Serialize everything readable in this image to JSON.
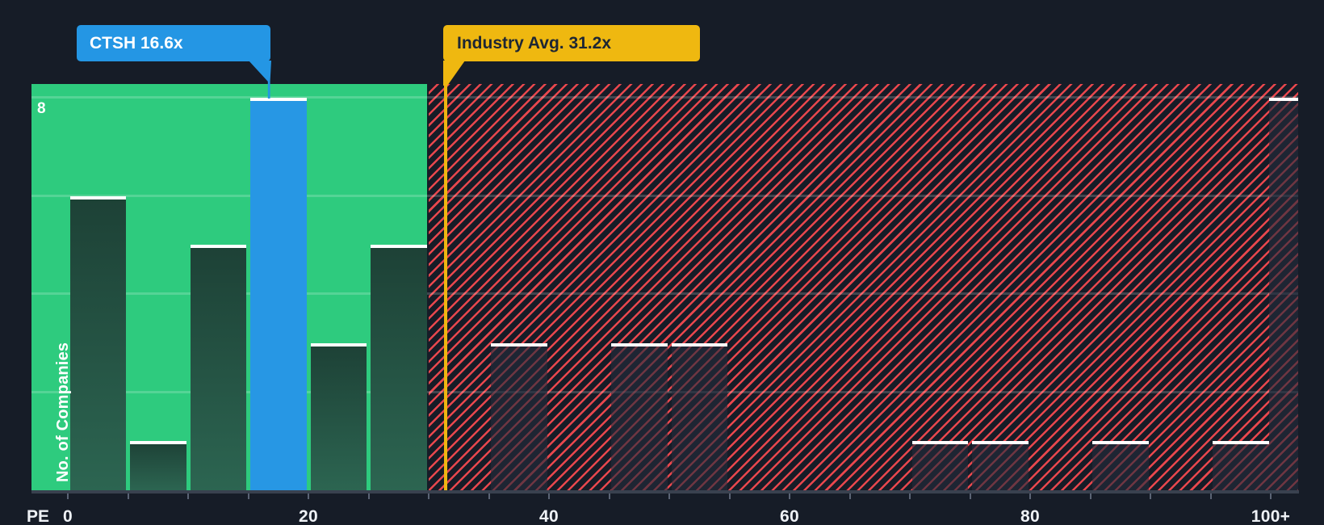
{
  "tooltips": {
    "company": {
      "label": "CTSH 16.6x",
      "color": "#2496e4",
      "text_color": "#ffffff"
    },
    "industry": {
      "label": "Industry Avg. 31.2x",
      "color": "#efb810",
      "text_color": "#1d2634"
    }
  },
  "axes": {
    "x_title": "PE",
    "y_title": "No. of Companies",
    "y_max_label": "8"
  },
  "chart_data": {
    "type": "bar",
    "title": "PE ratio histogram vs industry",
    "xlabel": "PE",
    "ylabel": "No. of Companies",
    "ylim": [
      0,
      8.3
    ],
    "xlim": [
      -3,
      102.5
    ],
    "grid": true,
    "gridline_values": [
      2,
      4,
      6,
      8
    ],
    "x_ticks": [
      {
        "pe": 0,
        "label": "0"
      },
      {
        "pe": 20,
        "label": "20"
      },
      {
        "pe": 40,
        "label": "40"
      },
      {
        "pe": 60,
        "label": "60"
      },
      {
        "pe": 80,
        "label": "80"
      },
      {
        "pe": 100,
        "label": "100+"
      }
    ],
    "bin_width": 5,
    "bins": [
      {
        "start": 0,
        "end": 5,
        "count": 6
      },
      {
        "start": 5,
        "end": 10,
        "count": 1
      },
      {
        "start": 10,
        "end": 15,
        "count": 5
      },
      {
        "start": 15,
        "end": 20,
        "count": 8,
        "highlight": "company"
      },
      {
        "start": 20,
        "end": 25,
        "count": 3
      },
      {
        "start": 25,
        "end": 30,
        "count": 5
      },
      {
        "start": 30,
        "end": 35,
        "count": 0
      },
      {
        "start": 35,
        "end": 40,
        "count": 3
      },
      {
        "start": 40,
        "end": 45,
        "count": 0
      },
      {
        "start": 45,
        "end": 50,
        "count": 3
      },
      {
        "start": 50,
        "end": 55,
        "count": 3
      },
      {
        "start": 55,
        "end": 60,
        "count": 0
      },
      {
        "start": 60,
        "end": 65,
        "count": 0
      },
      {
        "start": 65,
        "end": 70,
        "count": 0
      },
      {
        "start": 70,
        "end": 75,
        "count": 1
      },
      {
        "start": 75,
        "end": 80,
        "count": 1
      },
      {
        "start": 80,
        "end": 85,
        "count": 0
      },
      {
        "start": 85,
        "end": 90,
        "count": 1
      },
      {
        "start": 90,
        "end": 95,
        "count": 0
      },
      {
        "start": 95,
        "end": 100,
        "count": 1
      },
      {
        "start": 100,
        "end": 102.5,
        "count": 8,
        "label": "100+"
      }
    ],
    "company_marker": {
      "ticker": "CTSH",
      "pe": 16.6,
      "bin_start": 15,
      "count": 8
    },
    "industry_average": 31.2,
    "zones": [
      {
        "from": 0,
        "to": 30,
        "style": "green"
      },
      {
        "from": 30,
        "to": 102.5,
        "style": "red-hatch"
      }
    ],
    "legend": "none",
    "colors": {
      "background": "#161c27",
      "green_zone": "#2ecb7e",
      "green_bar_top": "#1d4136",
      "green_bar_bottom": "#2c6551",
      "company_bar": "#2797e4",
      "hatch_stripe": "#e8474d",
      "dark_bar_overlay": "rgba(35,44,60,0.62)",
      "avg_line": "#eeb611",
      "bar_cap": "#ffffff",
      "axis_line": "#39414f",
      "tick": "#5a6374",
      "label_text": "#eef1f5"
    }
  }
}
